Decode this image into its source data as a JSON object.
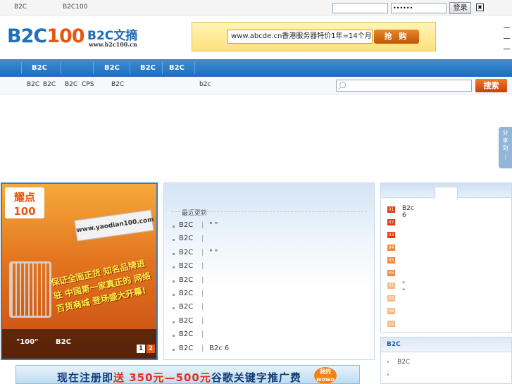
{
  "topbar": {
    "links": [
      "B2C",
      "B2C100"
    ],
    "username_value": "",
    "password_value": "••••••",
    "login_label": "登录",
    "close_label": "✖"
  },
  "header": {
    "logo_main": "B2C",
    "logo_number": "100",
    "logo_sub": "B2C文摘",
    "logo_url": "www.b2c100.cn",
    "ad_text": "www.abcde.cn香港服务器特价1年=14个月",
    "ad_button": "抢 购"
  },
  "nav": {
    "items": [
      "B2C",
      "B2C",
      "B2C",
      "B2C"
    ]
  },
  "subnav": {
    "items": [
      "B2C",
      "B2C",
      "B2C",
      "CPS",
      "B2C",
      "b2c"
    ],
    "search_placeholder": "",
    "search_button": "搜索"
  },
  "share_tab": "分享到",
  "slideshow": {
    "logo_badge": "耀点100",
    "site_url": "www.yaodian100.com",
    "slogan": "保证全面正货 知名品牌进驻 中国第一家真正的 网络百货商城 登场盛大开幕!",
    "caption_left": "\"100\"",
    "caption_right": "B2C",
    "pages": [
      "1",
      "2"
    ]
  },
  "news": {
    "header": "最近更新",
    "rows": [
      {
        "cat": "B2C",
        "title": "\"          \""
      },
      {
        "cat": "B2C",
        "title": ""
      },
      {
        "cat": "B2C",
        "title": "\" \""
      },
      {
        "cat": "B2C",
        "title": ""
      },
      {
        "cat": "B2C",
        "title": ""
      },
      {
        "cat": "B2C",
        "title": ""
      },
      {
        "cat": "B2C",
        "title": ""
      },
      {
        "cat": "B2C",
        "title": ""
      },
      {
        "cat": "B2C",
        "title": ""
      },
      {
        "cat": "B2C",
        "title": "B2c 6"
      }
    ]
  },
  "ranking": {
    "items": [
      {
        "num": "01",
        "text": "B2c 6"
      },
      {
        "num": "02",
        "text": ""
      },
      {
        "num": "03",
        "text": ""
      },
      {
        "num": "04",
        "text": ""
      },
      {
        "num": "05",
        "text": ""
      },
      {
        "num": "06",
        "text": ""
      },
      {
        "num": "07",
        "text": "\"  \""
      },
      {
        "num": "08",
        "text": ""
      },
      {
        "num": "09",
        "text": ""
      },
      {
        "num": "10",
        "text": ""
      }
    ],
    "colors": {
      "top": "#e03a14",
      "mid": "#f28a3a",
      "low": "#f7b98a"
    }
  },
  "b2c_panel": {
    "title": "B2C",
    "items": [
      "B2C",
      ""
    ]
  },
  "bottom_banner": {
    "text_a": "现在注册即",
    "text_hl": "送 350元—500元",
    "text_b": "谷歌关键字推广费",
    "badge": "我的 wowo"
  }
}
